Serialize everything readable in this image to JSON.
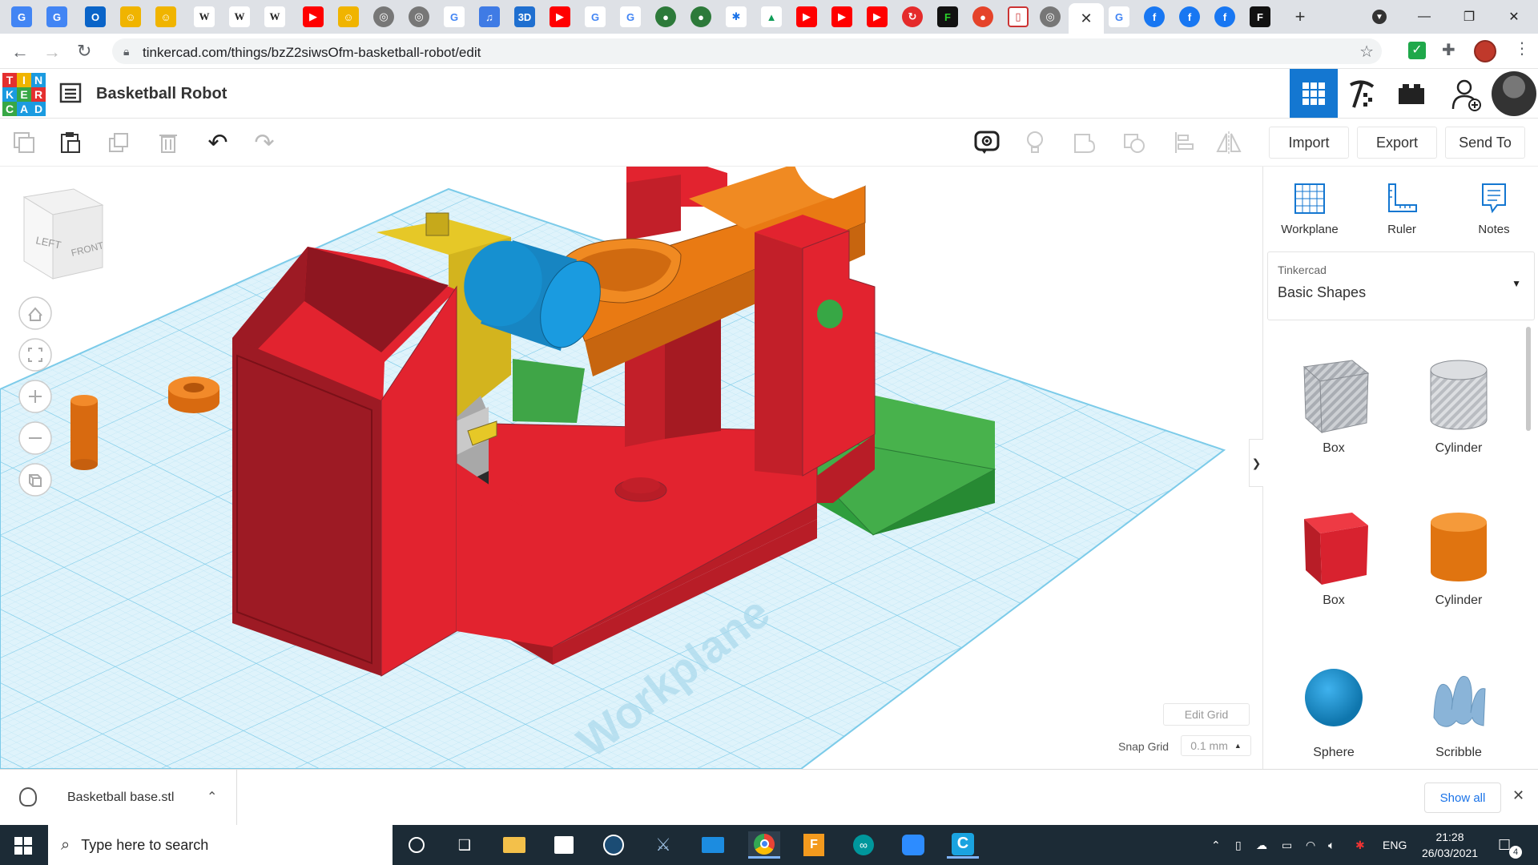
{
  "browser": {
    "url": "tinkercad.com/things/bzZ2siwsOfm-basketball-robot/edit",
    "tab_close_glyph": "✕"
  },
  "app": {
    "design_title": "Basketball Robot",
    "logo_letters": [
      "T",
      "I",
      "N",
      "K",
      "E",
      "R",
      "C",
      "A",
      "D"
    ]
  },
  "toolbar": {
    "import_label": "Import",
    "export_label": "Export",
    "send_to_label": "Send To"
  },
  "viewcube": {
    "left_label": "LEFT",
    "front_label": "FRONT"
  },
  "workplane": {
    "label": "Workplane",
    "edit_grid_label": "Edit Grid",
    "snap_grid_label": "Snap Grid",
    "snap_grid_value": "0.1 mm"
  },
  "panel": {
    "tools": [
      {
        "label": "Workplane",
        "icon": "workplane-icon"
      },
      {
        "label": "Ruler",
        "icon": "ruler-icon"
      },
      {
        "label": "Notes",
        "icon": "notes-icon"
      }
    ],
    "library_source": "Tinkercad",
    "library_name": "Basic Shapes",
    "shapes": [
      {
        "label": "Box",
        "color": "#a9adb3"
      },
      {
        "label": "Cylinder",
        "color": "#b9bcc1"
      },
      {
        "label": "Box",
        "color": "#d8222f"
      },
      {
        "label": "Cylinder",
        "color": "#e97a13"
      },
      {
        "label": "Sphere",
        "color": "#1690d0"
      },
      {
        "label": "Scribble",
        "color": "#8ab4d8"
      }
    ],
    "collapse_glyph": "❯"
  },
  "download": {
    "filename": "Basketball base.stl",
    "show_all_label": "Show all"
  },
  "taskbar": {
    "search_placeholder": "Type here to search",
    "language": "ENG",
    "time": "21:28",
    "date": "26/03/2021",
    "notification_count": "4"
  },
  "colors": {
    "accent_blue": "#1477d1",
    "model_red": "#d8222f",
    "model_orange": "#e97a13",
    "model_green": "#2f9e3d",
    "model_yellow": "#e6c827",
    "model_blue": "#1690d0",
    "grid_blue": "#a6dcf1"
  }
}
